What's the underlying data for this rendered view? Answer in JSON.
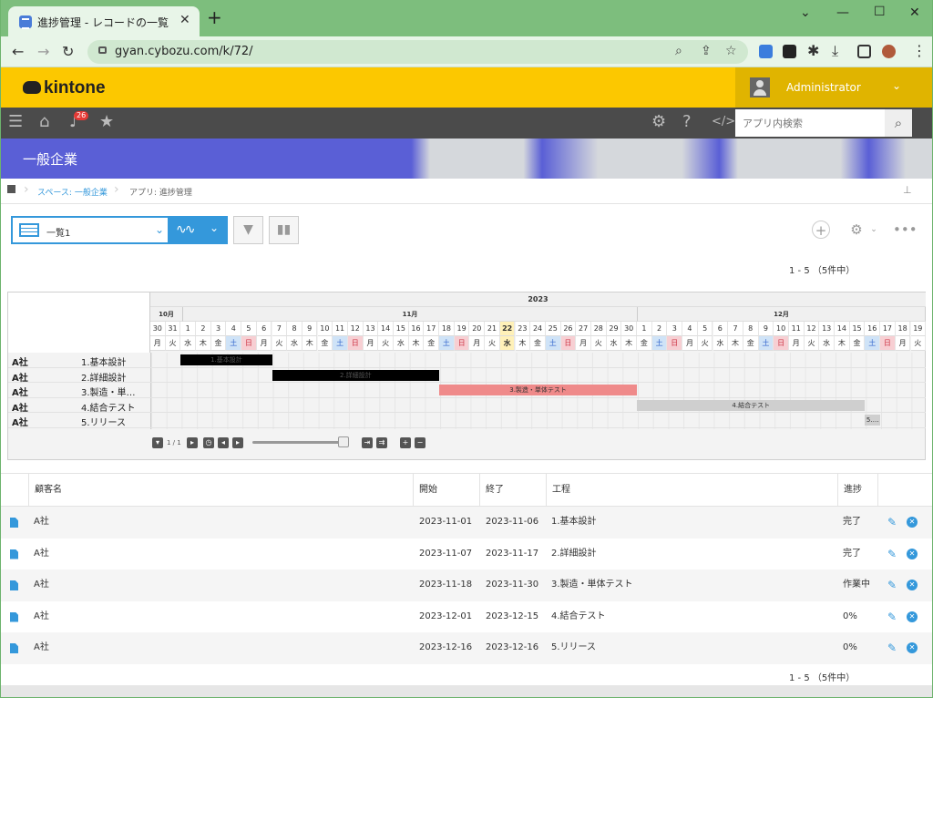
{
  "browser": {
    "tab_title": "進捗管理 - レコードの一覧",
    "url": "gyan.cybozu.com/k/72/"
  },
  "header": {
    "logo_text": "kintone",
    "user_name": "Administrator",
    "notification_count": "26",
    "search_placeholder": "アプリ内検索"
  },
  "space": {
    "title": "一般企業"
  },
  "breadcrumb": {
    "space": "スペース: 一般企業",
    "app": "アプリ: 進捗管理"
  },
  "view": {
    "selected": "一覧1",
    "pager": "1 - 5 （5件中）"
  },
  "gantt": {
    "year": "2023",
    "months": [
      {
        "label": "10月"
      },
      {
        "label": "11月"
      },
      {
        "label": "12月"
      }
    ],
    "days": [
      {
        "d": "30",
        "w": "月",
        "t": ""
      },
      {
        "d": "31",
        "w": "火",
        "t": ""
      },
      {
        "d": "1",
        "w": "水",
        "t": ""
      },
      {
        "d": "2",
        "w": "木",
        "t": ""
      },
      {
        "d": "3",
        "w": "金",
        "t": ""
      },
      {
        "d": "4",
        "w": "土",
        "t": "sat"
      },
      {
        "d": "5",
        "w": "日",
        "t": "sun"
      },
      {
        "d": "6",
        "w": "月",
        "t": ""
      },
      {
        "d": "7",
        "w": "火",
        "t": ""
      },
      {
        "d": "8",
        "w": "水",
        "t": ""
      },
      {
        "d": "9",
        "w": "木",
        "t": ""
      },
      {
        "d": "10",
        "w": "金",
        "t": ""
      },
      {
        "d": "11",
        "w": "土",
        "t": "sat"
      },
      {
        "d": "12",
        "w": "日",
        "t": "sun"
      },
      {
        "d": "13",
        "w": "月",
        "t": ""
      },
      {
        "d": "14",
        "w": "火",
        "t": ""
      },
      {
        "d": "15",
        "w": "水",
        "t": ""
      },
      {
        "d": "16",
        "w": "木",
        "t": ""
      },
      {
        "d": "17",
        "w": "金",
        "t": ""
      },
      {
        "d": "18",
        "w": "土",
        "t": "sat"
      },
      {
        "d": "19",
        "w": "日",
        "t": "sun"
      },
      {
        "d": "20",
        "w": "月",
        "t": ""
      },
      {
        "d": "21",
        "w": "火",
        "t": ""
      },
      {
        "d": "22",
        "w": "水",
        "t": "today"
      },
      {
        "d": "23",
        "w": "木",
        "t": ""
      },
      {
        "d": "24",
        "w": "金",
        "t": ""
      },
      {
        "d": "25",
        "w": "土",
        "t": "sat"
      },
      {
        "d": "26",
        "w": "日",
        "t": "sun"
      },
      {
        "d": "27",
        "w": "月",
        "t": ""
      },
      {
        "d": "28",
        "w": "火",
        "t": ""
      },
      {
        "d": "29",
        "w": "水",
        "t": ""
      },
      {
        "d": "30",
        "w": "木",
        "t": ""
      },
      {
        "d": "1",
        "w": "金",
        "t": ""
      },
      {
        "d": "2",
        "w": "土",
        "t": "sat"
      },
      {
        "d": "3",
        "w": "日",
        "t": "sun"
      },
      {
        "d": "4",
        "w": "月",
        "t": ""
      },
      {
        "d": "5",
        "w": "火",
        "t": ""
      },
      {
        "d": "6",
        "w": "水",
        "t": ""
      },
      {
        "d": "7",
        "w": "木",
        "t": ""
      },
      {
        "d": "8",
        "w": "金",
        "t": ""
      },
      {
        "d": "9",
        "w": "土",
        "t": "sat"
      },
      {
        "d": "10",
        "w": "日",
        "t": "sun"
      },
      {
        "d": "11",
        "w": "月",
        "t": ""
      },
      {
        "d": "12",
        "w": "火",
        "t": ""
      },
      {
        "d": "13",
        "w": "水",
        "t": ""
      },
      {
        "d": "14",
        "w": "木",
        "t": ""
      },
      {
        "d": "15",
        "w": "金",
        "t": ""
      },
      {
        "d": "16",
        "w": "土",
        "t": "sat"
      },
      {
        "d": "17",
        "w": "日",
        "t": "sun"
      },
      {
        "d": "18",
        "w": "月",
        "t": ""
      },
      {
        "d": "19",
        "w": "火",
        "t": ""
      }
    ],
    "rows": [
      {
        "customer": "A社",
        "task": "1.基本設計",
        "bar_label": "1.基本設計",
        "color": "#000000",
        "text_color": "#555555"
      },
      {
        "customer": "A社",
        "task": "2.詳細設計",
        "bar_label": "2.詳細設計",
        "color": "#000000",
        "text_color": "#555555"
      },
      {
        "customer": "A社",
        "task": "3.製造・単…",
        "bar_label": "3.製造・単体テスト",
        "color": "#ef8a8a",
        "text_color": "#333333"
      },
      {
        "customer": "A社",
        "task": "4.結合テスト",
        "bar_label": "4.結合テスト",
        "color": "#cfcfcf",
        "text_color": "#333333"
      },
      {
        "customer": "A社",
        "task": "5.リリース",
        "bar_label": "5.…",
        "color": "#cfcfcf",
        "text_color": "#333333"
      }
    ],
    "page_info": "1 / 1"
  },
  "list": {
    "headers": {
      "customer": "顧客名",
      "start": "開始",
      "end": "終了",
      "process": "工程",
      "progress": "進捗"
    },
    "records": [
      {
        "customer": "A社",
        "start": "2023-11-01",
        "end": "2023-11-06",
        "process": "1.基本設計",
        "progress": "完了"
      },
      {
        "customer": "A社",
        "start": "2023-11-07",
        "end": "2023-11-17",
        "process": "2.詳細設計",
        "progress": "完了"
      },
      {
        "customer": "A社",
        "start": "2023-11-18",
        "end": "2023-11-30",
        "process": "3.製造・単体テスト",
        "progress": "作業中"
      },
      {
        "customer": "A社",
        "start": "2023-12-01",
        "end": "2023-12-15",
        "process": "4.結合テスト",
        "progress": "0%"
      },
      {
        "customer": "A社",
        "start": "2023-12-16",
        "end": "2023-12-16",
        "process": "5.リリース",
        "progress": "0%"
      }
    ]
  },
  "colors": {
    "kintone_yellow": "#fcc800",
    "accent_blue": "#3498db",
    "saturday": "#cfe3f7",
    "sunday": "#f7cfd3",
    "today": "#fff1b8"
  }
}
